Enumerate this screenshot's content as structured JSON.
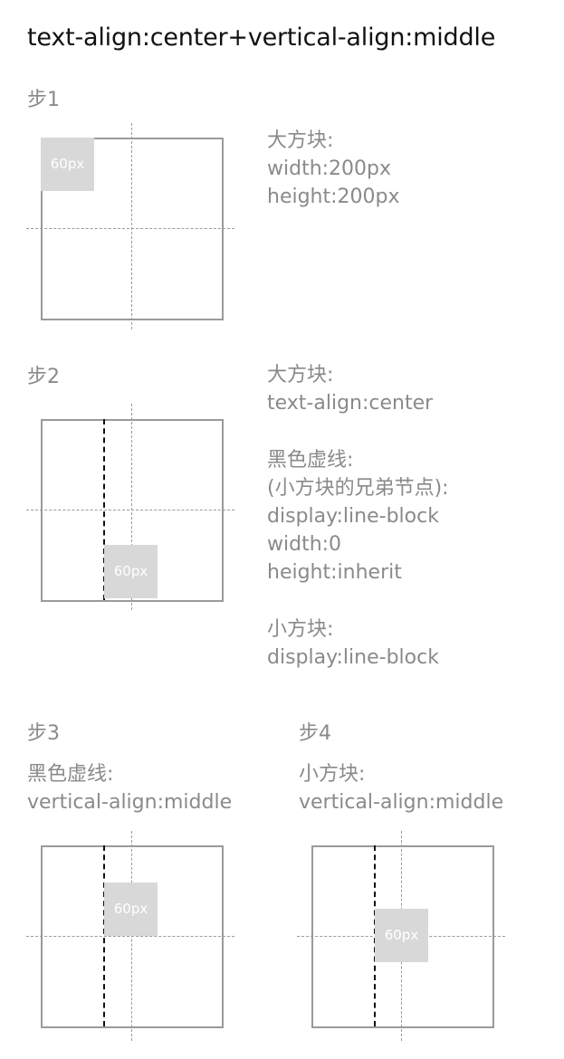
{
  "title": "text-align:center+vertical-align:middle",
  "small_box_label": "60px",
  "steps": [
    {
      "label": "步1",
      "description": [
        "大方块:",
        "width:200px",
        "height:200px"
      ]
    },
    {
      "label": "步2",
      "description_blocks": [
        [
          "大方块:",
          "text-align:center"
        ],
        [
          "黑色虚线:",
          "(小方块的兄弟节点):",
          "display:line-block",
          "width:0",
          "height:inherit"
        ],
        [
          "小方块:",
          "display:line-block"
        ]
      ]
    },
    {
      "label": "步3",
      "description": [
        "黑色虚线:",
        "vertical-align:middle"
      ]
    },
    {
      "label": "步4",
      "description": [
        "小方块:",
        "vertical-align:middle"
      ]
    }
  ],
  "colors": {
    "title": "#111111",
    "label_text": "#8a8a8a",
    "box_border": "#9a9a9a",
    "axis_dash": "#9a9a9a",
    "black_dash": "#111111",
    "small_box_fill": "#d8d8d8",
    "small_box_text": "#ffffff"
  }
}
